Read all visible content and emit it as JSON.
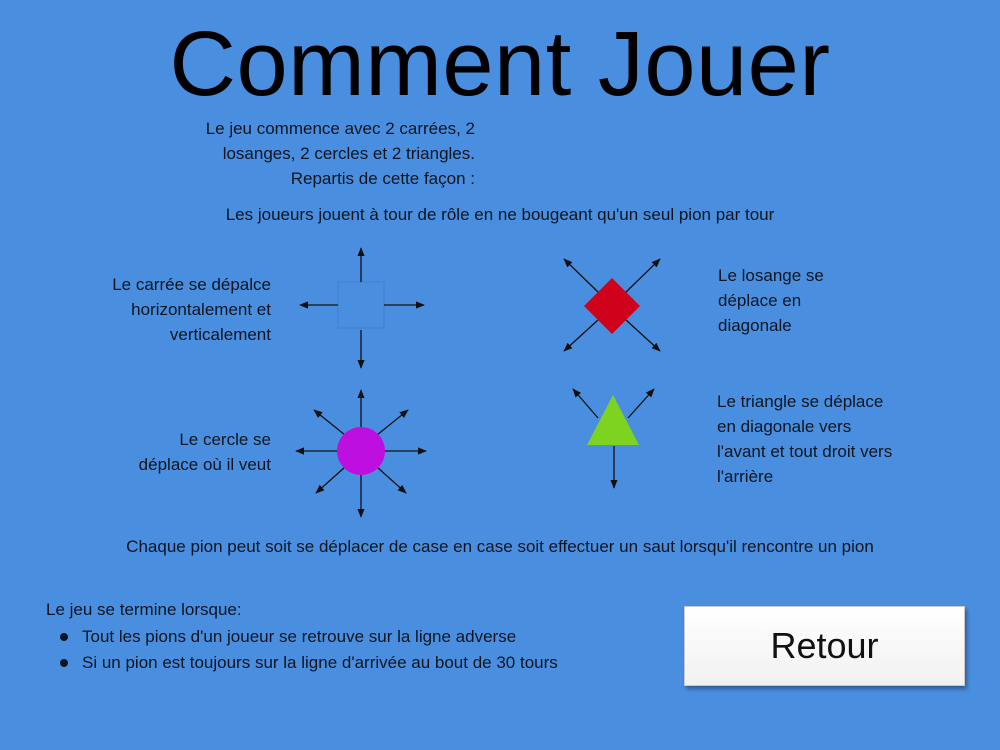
{
  "title": "Comment Jouer",
  "intro": {
    "line1": "Le jeu commence avec 2 carrées, 2",
    "line2": "losanges, 2 cercles et 2 triangles.",
    "line3": "Repartis de cette façon :"
  },
  "turns_text": "Les joueurs jouent à tour de rôle en ne bougeant qu'un seul pion par tour",
  "pieces": {
    "square": {
      "line1": "Le carrée se dépalce",
      "line2": "horizontalement et",
      "line3": "verticalement",
      "color": "#4a8ee0"
    },
    "diamond": {
      "line1": "Le losange se",
      "line2": "déplace en",
      "line3": "diagonale",
      "color": "#d0021b"
    },
    "circle": {
      "line1": "Le cercle se",
      "line2": "déplace où il veut",
      "color": "#bd10e0"
    },
    "triangle": {
      "line1": "Le triangle se déplace",
      "line2": "en diagonale vers",
      "line3": "l'avant et tout droit vers",
      "line4": "l'arrière",
      "color": "#7ed321"
    }
  },
  "jump_rule": "Chaque pion peut soit se déplacer de case en case soit effectuer un saut lorsqu'il rencontre un pion",
  "end": {
    "heading": "Le jeu se termine lorsque:",
    "items": [
      "Tout les pions d'un joueur se retrouve sur la ligne adverse",
      "Si un pion est toujours sur la ligne d'arrivée au bout de 30 tours"
    ]
  },
  "back_button": "Retour",
  "colors": {
    "background": "#4a8ee0",
    "text": "#0d1620"
  }
}
